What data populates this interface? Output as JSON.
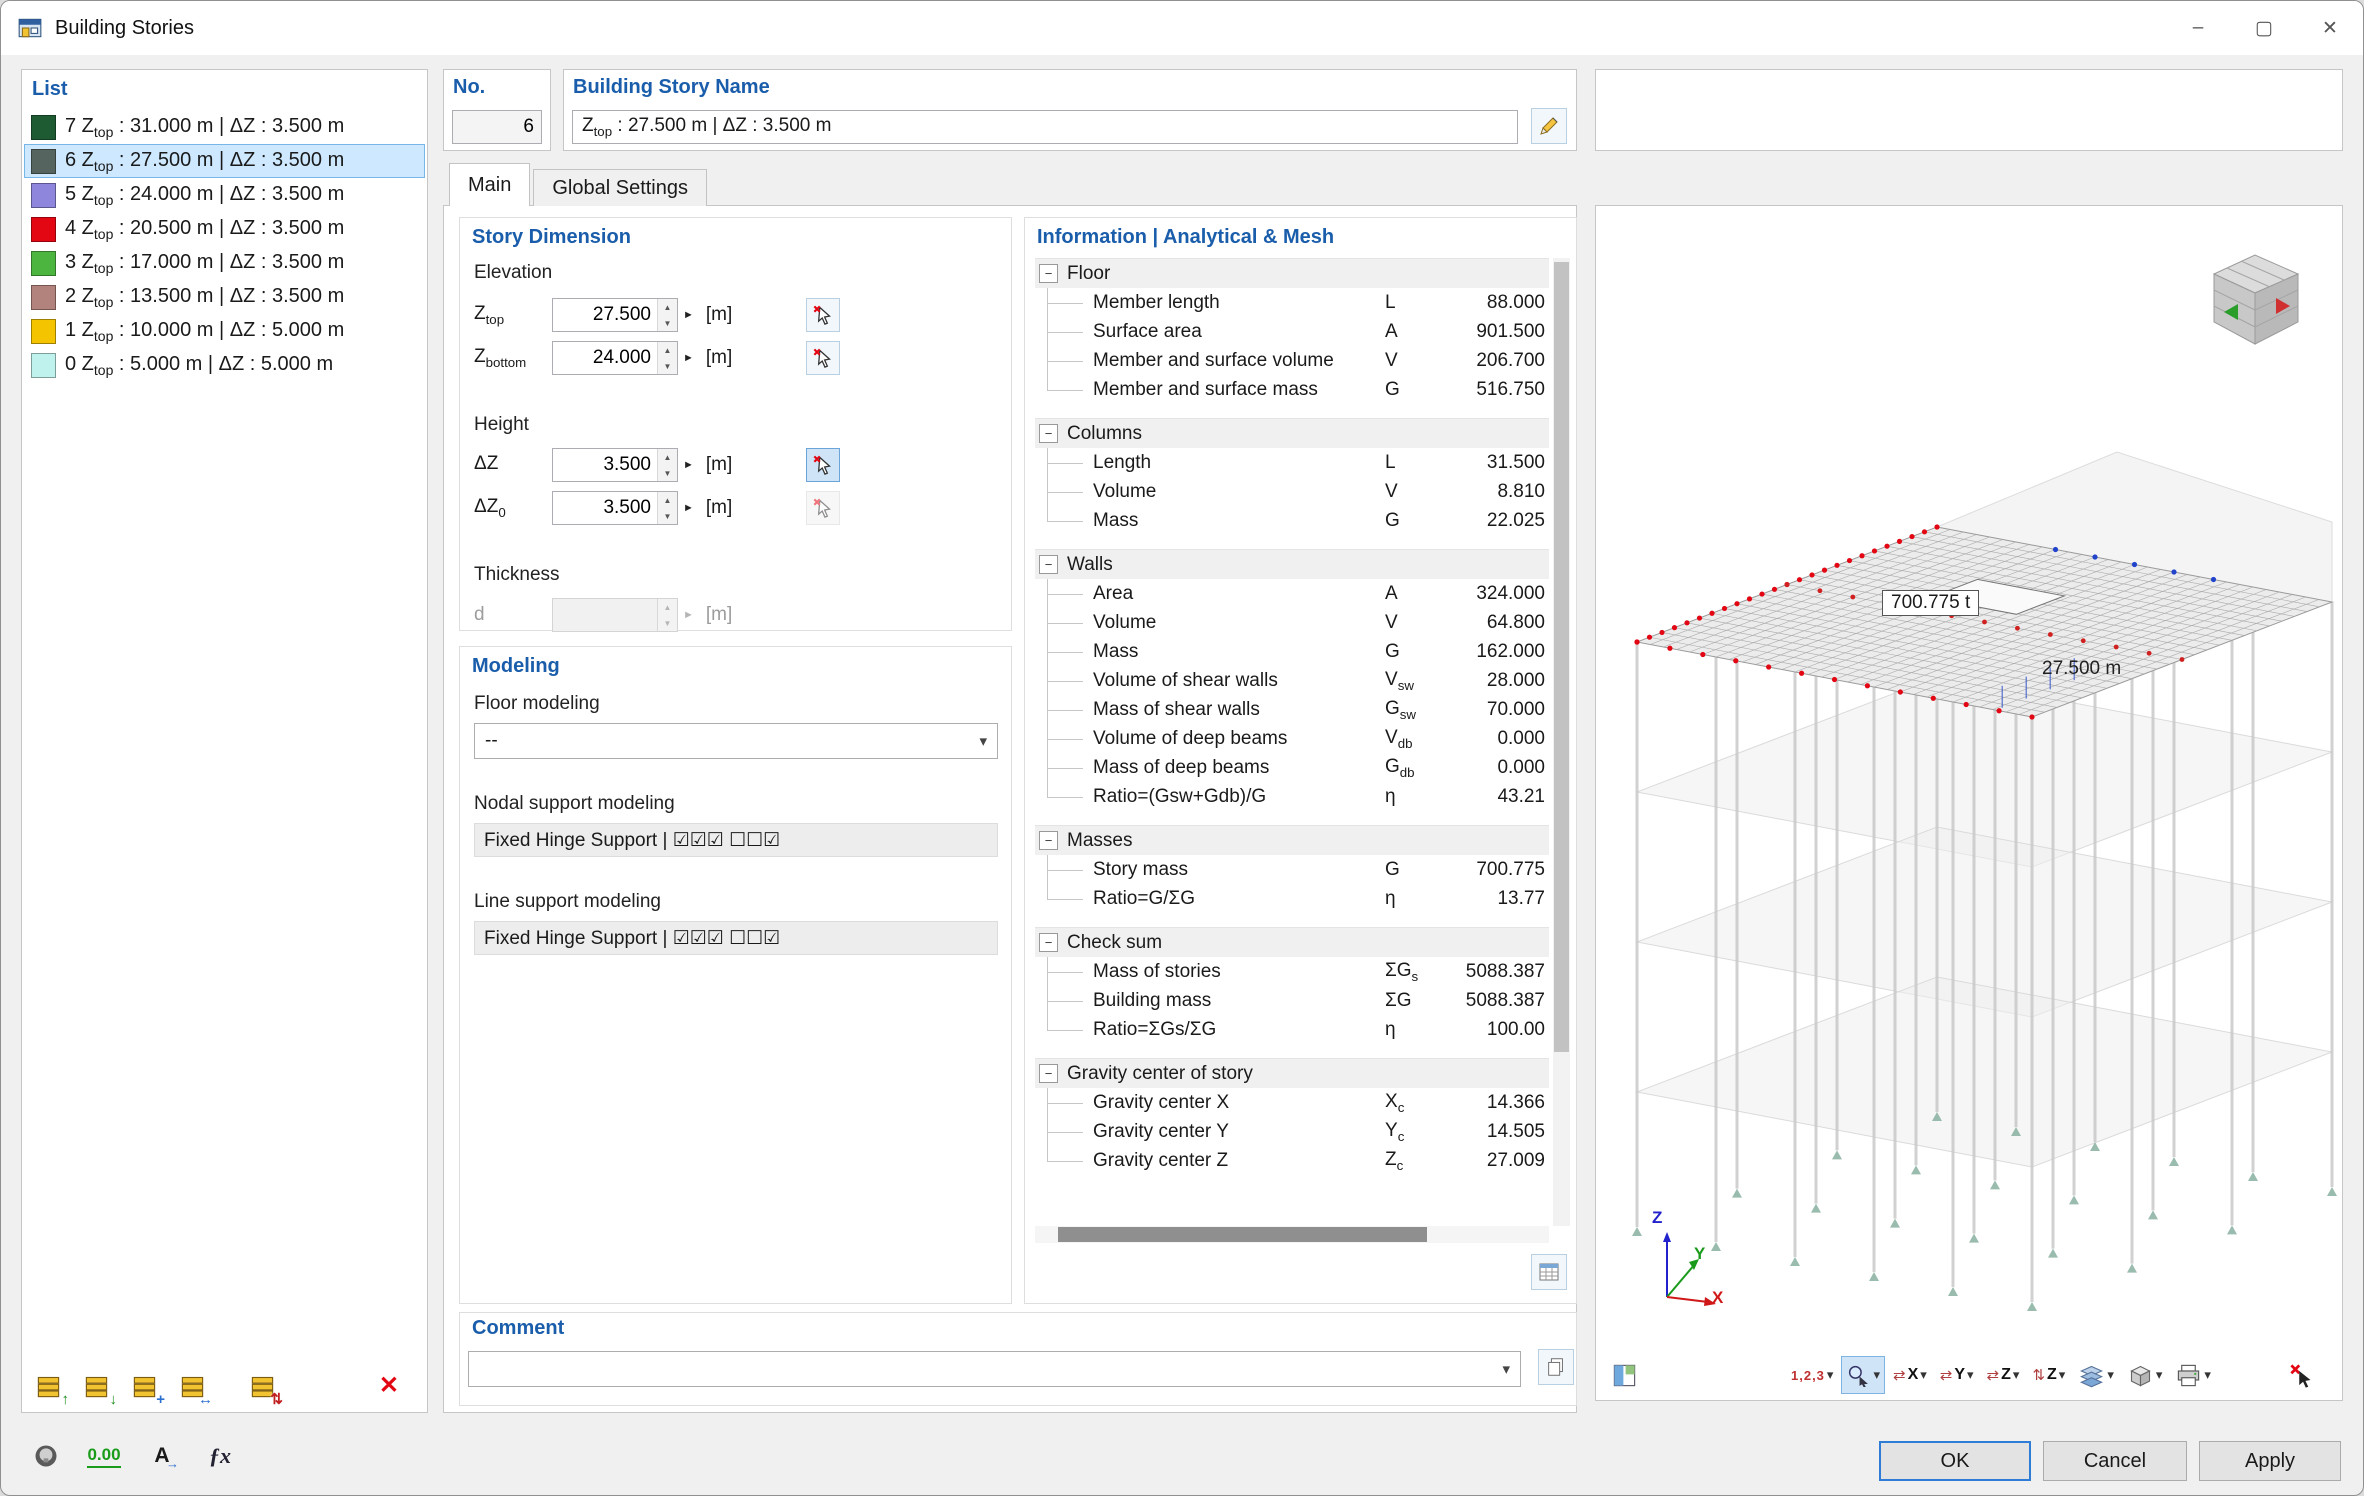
{
  "window": {
    "title": "Building Stories"
  },
  "titlebar": {
    "minimize": "–",
    "maximize": "▢",
    "close": "✕"
  },
  "glyphs": {
    "spin_up": "▲",
    "spin_down": "▼",
    "param_arrow": "►",
    "caret": "▾",
    "chevron": "▾",
    "collapse": "−",
    "axis_lr": "⇄",
    "axis_ud": "⇅"
  },
  "list_panel": {
    "header": "List",
    "items": [
      {
        "no": "7",
        "z": "Z",
        "sub": "top",
        "rest": " : 31.000 m | ΔZ : 3.500 m",
        "color": "#1e5b33",
        "selected": false
      },
      {
        "no": "6",
        "z": "Z",
        "sub": "top",
        "rest": " : 27.500 m | ΔZ : 3.500 m",
        "color": "#55645f",
        "selected": true
      },
      {
        "no": "5",
        "z": "Z",
        "sub": "top",
        "rest": " : 24.000 m | ΔZ : 3.500 m",
        "color": "#8e85dc",
        "selected": false
      },
      {
        "no": "4",
        "z": "Z",
        "sub": "top",
        "rest": " : 20.500 m | ΔZ : 3.500 m",
        "color": "#e30613",
        "selected": false
      },
      {
        "no": "3",
        "z": "Z",
        "sub": "top",
        "rest": " : 17.000 m | ΔZ : 3.500 m",
        "color": "#4cb540",
        "selected": false
      },
      {
        "no": "2",
        "z": "Z",
        "sub": "top",
        "rest": " : 13.500 m | ΔZ : 3.500 m",
        "color": "#b2837c",
        "selected": false
      },
      {
        "no": "1",
        "z": "Z",
        "sub": "top",
        "rest": " : 10.000 m | ΔZ : 5.000 m",
        "color": "#f4c400",
        "selected": false
      },
      {
        "no": "0",
        "z": "Z",
        "sub": "top",
        "rest": " : 5.000 m | ΔZ : 5.000 m",
        "color": "#bff2ec",
        "selected": false
      }
    ],
    "toolbar": [
      {
        "name": "new-story-above-button",
        "arrow": "↑",
        "arrowColor": "#1a8a1a"
      },
      {
        "name": "new-story-below-button",
        "arrow": "↓",
        "arrowColor": "#1a8a1a"
      },
      {
        "name": "insert-story-button",
        "arrow": "+",
        "arrowColor": "#2a6fd0"
      },
      {
        "name": "copy-story-button",
        "arrow": "↔",
        "arrowColor": "#2a6fd0"
      },
      {
        "name": "renumber-stories-button",
        "arrow": "⇅",
        "arrowColor": "#c02020"
      }
    ],
    "delete_label": "✕"
  },
  "header_fields": {
    "no_label": "No.",
    "no_value": "6",
    "name_label": "Building Story Name",
    "name_z": "Z",
    "name_sub": "top",
    "name_rest": " : 27.500 m | ΔZ : 3.500 m"
  },
  "tabs": [
    {
      "label": "Main",
      "active": true
    },
    {
      "label": "Global Settings",
      "active": false
    }
  ],
  "story_dimension": {
    "title": "Story Dimension",
    "elevation_label": "Elevation",
    "height_label": "Height",
    "thickness_label": "Thickness",
    "unit_m": "[m]",
    "ztop": {
      "sym": "Z",
      "sub": "top",
      "value": "27.500"
    },
    "zbottom": {
      "sym": "Z",
      "sub": "bottom",
      "value": "24.000"
    },
    "dz": {
      "sym": "ΔZ",
      "sub": "",
      "value": "3.500"
    },
    "dz0": {
      "sym": "ΔZ",
      "sub": "0",
      "value": "3.500"
    },
    "d": {
      "sym": "d",
      "value": ""
    }
  },
  "modeling": {
    "title": "Modeling",
    "floor_label": "Floor modeling",
    "floor_value": "--",
    "nodal_label": "Nodal support modeling",
    "nodal_value": "Fixed Hinge Support | ☑☑☑ ☐☐☑",
    "line_label": "Line support modeling",
    "line_value": "Fixed Hinge Support | ☑☑☑ ☐☐☑"
  },
  "info_table": {
    "title": "Information | Analytical & Mesh",
    "groups": [
      {
        "name": "Floor",
        "rows": [
          {
            "label": "Member length",
            "sym": "L",
            "sub": "",
            "value": "88.000"
          },
          {
            "label": "Surface area",
            "sym": "A",
            "sub": "",
            "value": "901.500"
          },
          {
            "label": "Member and surface volume",
            "sym": "V",
            "sub": "",
            "value": "206.700"
          },
          {
            "label": "Member and surface mass",
            "sym": "G",
            "sub": "",
            "value": "516.750"
          }
        ]
      },
      {
        "name": "Columns",
        "rows": [
          {
            "label": "Length",
            "sym": "L",
            "sub": "",
            "value": "31.500"
          },
          {
            "label": "Volume",
            "sym": "V",
            "sub": "",
            "value": "8.810"
          },
          {
            "label": "Mass",
            "sym": "G",
            "sub": "",
            "value": "22.025"
          }
        ]
      },
      {
        "name": "Walls",
        "rows": [
          {
            "label": "Area",
            "sym": "A",
            "sub": "",
            "value": "324.000"
          },
          {
            "label": "Volume",
            "sym": "V",
            "sub": "",
            "value": "64.800"
          },
          {
            "label": "Mass",
            "sym": "G",
            "sub": "",
            "value": "162.000"
          },
          {
            "label": "Volume of shear walls",
            "sym": "V",
            "sub": "sw",
            "value": "28.000"
          },
          {
            "label": "Mass of shear walls",
            "sym": "G",
            "sub": "sw",
            "value": "70.000"
          },
          {
            "label": "Volume of deep beams",
            "sym": "V",
            "sub": "db",
            "value": "0.000"
          },
          {
            "label": "Mass of deep beams",
            "sym": "G",
            "sub": "db",
            "value": "0.000"
          },
          {
            "label": "Ratio=(Gsw+Gdb)/G",
            "sym": "η",
            "sub": "",
            "value": "43.21"
          }
        ]
      },
      {
        "name": "Masses",
        "rows": [
          {
            "label": "Story mass",
            "sym": "G",
            "sub": "",
            "value": "700.775"
          },
          {
            "label": "Ratio=G/ΣG",
            "sym": "η",
            "sub": "",
            "value": "13.77"
          }
        ]
      },
      {
        "name": "Check sum",
        "rows": [
          {
            "label": "Mass of stories",
            "sym": "ΣG",
            "sub": "s",
            "value": "5088.387"
          },
          {
            "label": "Building mass",
            "sym": "ΣG",
            "sub": "",
            "value": "5088.387"
          },
          {
            "label": "Ratio=ΣGs/ΣG",
            "sym": "η",
            "sub": "",
            "value": "100.00"
          }
        ]
      },
      {
        "name": "Gravity center of story",
        "rows": [
          {
            "label": "Gravity center X",
            "sym": "X",
            "sub": "c",
            "value": "14.366"
          },
          {
            "label": "Gravity center Y",
            "sym": "Y",
            "sub": "c",
            "value": "14.505"
          },
          {
            "label": "Gravity center Z",
            "sym": "Z",
            "sub": "c",
            "value": "27.009"
          }
        ]
      }
    ]
  },
  "comment": {
    "title": "Comment",
    "value": ""
  },
  "viewport": {
    "mass_label": "700.775 t",
    "elevation_label": "27.500 m",
    "axis_x": "X",
    "axis_y": "Y",
    "axis_z": "Z",
    "toolbar": [
      {
        "name": "graphic-options-button",
        "type": "panels",
        "dropdown": false,
        "active": false
      },
      {
        "name": "numbering-button",
        "type": "numbers",
        "label": "1,2,3",
        "dropdown": true,
        "active": false
      },
      {
        "name": "visibility-button",
        "type": "pointer-eye",
        "dropdown": true,
        "active": true
      },
      {
        "name": "view-x-button",
        "type": "axis",
        "label": "X",
        "dropdown": true,
        "active": false
      },
      {
        "name": "view-y-button",
        "type": "axis",
        "label": "Y",
        "dropdown": true,
        "active": false
      },
      {
        "name": "view-z-button",
        "type": "axis",
        "label": "Z",
        "dropdown": true,
        "active": false
      },
      {
        "name": "view-z-flip-button",
        "type": "axis-ud",
        "label": "Z",
        "dropdown": true,
        "active": false
      },
      {
        "name": "display-layers-button",
        "type": "layers",
        "dropdown": true,
        "active": false
      },
      {
        "name": "clipping-box-button",
        "type": "cube",
        "dropdown": true,
        "active": false
      },
      {
        "name": "print-button",
        "type": "printer",
        "dropdown": true,
        "active": false
      },
      {
        "name": "cancel-selection-button",
        "type": "red-pointer",
        "dropdown": false,
        "active": false
      }
    ]
  },
  "footer": {
    "ok": "OK",
    "cancel": "Cancel",
    "apply": "Apply",
    "decimal_label": "0.00",
    "font_label": "A",
    "font_arrow": "→",
    "formula_label": "ƒx"
  },
  "colors": {
    "accent_blue": "#1a5dab",
    "selection_bg": "#cde8ff",
    "alert_red": "#e30613"
  }
}
